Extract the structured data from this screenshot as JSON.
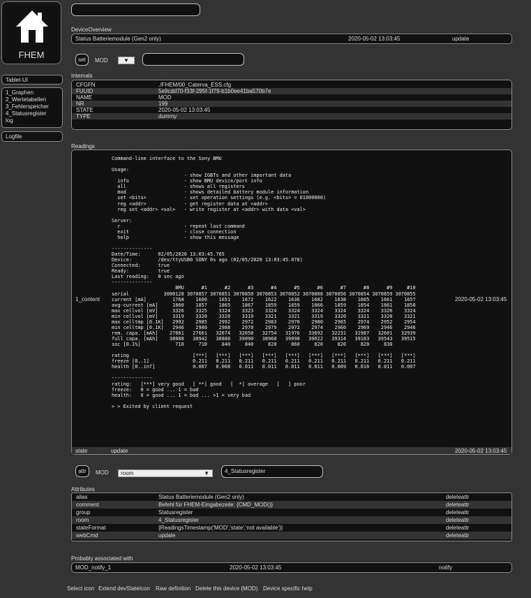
{
  "logo": {
    "text": "FHEM",
    "icon": "home-icon"
  },
  "menu1": {
    "items": [
      "Tablet-UI"
    ]
  },
  "menu2": {
    "items": [
      "1_Graphen",
      "2_Wertetabellen",
      "3_Fehlerspeicher",
      "4_Statusregister",
      "log"
    ]
  },
  "menu3": {
    "items": [
      "Logfile"
    ]
  },
  "top_input": {
    "value": ""
  },
  "overview": {
    "title": "DeviceOverview",
    "alias": "Status Batteriemodule (Gen2 only)",
    "time": "2020-05-02 13:03:45",
    "state": "update"
  },
  "set": {
    "button": "set",
    "device": "MOD",
    "dropdown_icon": "triangle-down-icon",
    "value": ""
  },
  "internals": {
    "title": "Internals",
    "rows": [
      {
        "name": "CFGFN",
        "value": "./FHEM/00_Caterva_ESS.cfg"
      },
      {
        "name": "FUUID",
        "value": "5e9cdd70-f33f-295f-1f79-b1b0ee41ba570b7e"
      },
      {
        "name": "NAME",
        "value": "MOD"
      },
      {
        "name": "NR",
        "value": "199"
      },
      {
        "name": "STATE",
        "value": "2020-05-02 13:03:45"
      },
      {
        "name": "TYPE",
        "value": "dummy"
      }
    ]
  },
  "readings": {
    "title": "Readings",
    "content_name": "1_content",
    "content_time": "2020-05-02 13:03:45",
    "state_name": "state",
    "state_value": "update",
    "state_time": "2020-05-02 13:03:45",
    "content": "Command-line interface to the Sony BMU\n\nUsage:\n                         - show IGBTs and other important data\n  info                   - show BMU device/port info\n  all                    - shows all registers\n  mod                    - shows detailed battery module information\n  set <bits>             - set operation settings (e.g. <bits> = 01000000)\n  reg <addr>             - get register data at <addr>\n  reg set <addr> <val>   - write register at <addr> with data <val>\n\nServer:\n  r                      - repeat last command\n  exit                   - close connection\n  help                   - show this message\n\n--------------\nDate/Time:      02/05/2020 13:03:45.765\nDevice:         /dev/ttyUSB0 SONY 0s ago (02/05/2020 13:03:45.078)\nConnected:      true\nReady:          true\nLast reading:   0 sec ago\n--------------\n                      BMU      #1      #2      #3      #4      #5      #6      #7      #8      #9     #10\nserial            3000128 3070857 3070851 3070850 3070853 3070852 3070808 3070856 3070854 3070859 3070855\ncurrent [mA]         1768    1660    1651    1672    1622    1636    1682    1638    1665    1661    1657\navg-current [mA]     1860    1857    1865    1867    1859    1859    1866    1859    1854    1861    1858\nmax cellvol [mV]     3326    3325    3324    3323    3324    3324    3324    3324    3324    3326    3324\nmin cellvol [mV]     3319    3320    3320    3319    3321    3321    3319    3320    3321    3320    3321\nmax celltmp [0.1K]   2992    2985    2992    2972    2983    2976    2980    2965    2974    2952    2954\nmin celltmp [0.1K]   2946    2980    2988    2970    2979    2972    2974    2960    2969    2946    2946\nrem. capa. [mAh]    27661   27661   32674   32658   32754   31976   33692   32231   31987   32601   32939\nfull capa. [mAh]    38888   38942   38888   39090   38968   39090   39022   39314   39183   39543   39515\nsoc [0.1%]            710     710     840     840     820     860     820     820     820     830\n\nrating                      [***]   [***]   [***]   [***]   [***]   [***]   [***]   [***]   [***]   [***]\nfreeze [0..1]               0.211   0.211   0.211   0.211   0.211   0.211   0.211   0.211   0.211   0.211\nhealth [0..inf]             0.007   0.008   0.011   0.011   0.011   0.011   0.009   0.016   0.011   0.007\n\n--------------\nrating:   [***] very good   [ **] good   [  *] average   [   ] poor\nfreeze:   0 = good ... 1 = bad\nhealth:   0 = good ... 1 = bad ... >1 = very bad\n\n> > Exited by client request"
  },
  "attr": {
    "button": "attr",
    "device": "MOD",
    "select_value": "room",
    "dropdown_icon": "triangle-down-icon",
    "value": "4_Statusregister"
  },
  "attributes": {
    "title": "Attributes",
    "rows": [
      {
        "name": "alias",
        "value": "Status Batteriemodule (Gen2 only)",
        "action": "deleteattr"
      },
      {
        "name": "comment",
        "value": "Befehl für FHEM-Eingabezeile: {CMD_MOD()}",
        "action": "deleteattr"
      },
      {
        "name": "group",
        "value": "Statusregister",
        "action": "deleteattr"
      },
      {
        "name": "room",
        "value": "4_Statusregister",
        "action": "deleteattr"
      },
      {
        "name": "stateFormat",
        "value": "{ReadingsTimestamp('MOD','state','not available')}",
        "action": "deleteattr"
      },
      {
        "name": "webCmd",
        "value": "update",
        "action": "deleteattr"
      }
    ]
  },
  "associated": {
    "title": "Probably associated with",
    "name": "MOD_notify_1",
    "time": "2020-05-02 13:03:45",
    "action": "notify"
  },
  "footer": {
    "links": [
      "Select icon",
      "Extend devStateIcon",
      "Raw definition",
      "Delete this device (MOD)",
      "Device specific help"
    ]
  }
}
